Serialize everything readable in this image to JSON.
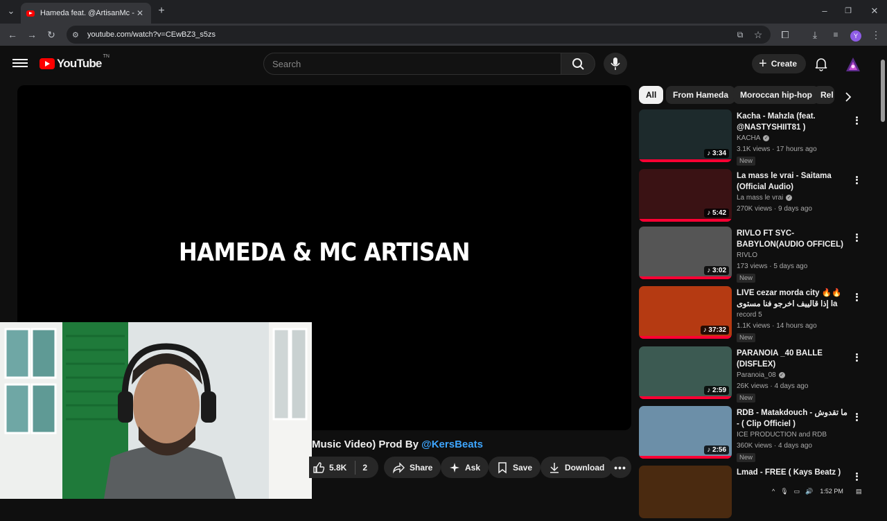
{
  "browser": {
    "tab_title": "Hameda feat. @ArtisanMc - We",
    "new_tab": "+",
    "url": "youtube.com/watch?v=CEwBZ3_s5zs"
  },
  "header": {
    "logo_text": "YouTube",
    "logo_region": "TN",
    "search_placeholder": "Search",
    "create_label": "Create"
  },
  "video": {
    "caption": "HAMEDA & MC ARTISAN",
    "title_visible": "Music Video) Prod By ",
    "title_handle": "@KersBeats"
  },
  "actions": {
    "likes": "5.8K",
    "comments": "2",
    "share": "Share",
    "ask": "Ask",
    "save": "Save",
    "download": "Download"
  },
  "chips": [
    "All",
    "From Hameda",
    "Moroccan hip-hop",
    "Rel"
  ],
  "recommendations": [
    {
      "title": "Kacha - Mahzla (feat. @NASTYSHIIT81 )",
      "channel": "KACHA",
      "verified": true,
      "views": "3.1K views",
      "age": "17 hours ago",
      "duration": "3:34",
      "badge": "New",
      "thumb_color": "#1d2a2c"
    },
    {
      "title": "La mass le vrai - Saitama (Official Audio)",
      "channel": "La mass le vrai",
      "verified": true,
      "views": "270K views",
      "age": "9 days ago",
      "duration": "5:42",
      "badge": "",
      "thumb_color": "#3a1214"
    },
    {
      "title": "RIVLO FT SYC-BABYLON(AUDIO OFFICEL)",
      "channel": "RIVLO",
      "verified": false,
      "views": "173 views",
      "age": "5 days ago",
      "duration": "3:02",
      "badge": "New",
      "thumb_color": "#555555"
    },
    {
      "title": "LIVE cezar morda city 🔥🔥 إذا قالييف اخرجو فنا مستوى la mass حابين",
      "channel": "record 5",
      "verified": false,
      "views": "1.1K views",
      "age": "14 hours ago",
      "duration": "37:32",
      "badge": "New",
      "thumb_color": "#b53a12"
    },
    {
      "title": "PARANOIA _40 BALLE (DISFLEX)",
      "channel": "Paranoia_08",
      "verified": true,
      "views": "26K views",
      "age": "4 days ago",
      "duration": "2:59",
      "badge": "New",
      "thumb_color": "#3c5a52"
    },
    {
      "title": "RDB - Matakdouch - ما تقدوش - ( Clip Officiel )",
      "channel": "ICE PRODUCTION and RDB",
      "verified": false,
      "views": "360K views",
      "age": "4 days ago",
      "duration": "2:56",
      "badge": "New",
      "thumb_color": "#6c8fa8"
    },
    {
      "title": "Lmad - FREE  ( Kays Beatz )",
      "channel": "",
      "verified": false,
      "views": "",
      "age": "",
      "duration": "",
      "badge": "",
      "thumb_color": "#4a2a10"
    }
  ],
  "taskbar": {
    "time": "1:52 PM"
  }
}
